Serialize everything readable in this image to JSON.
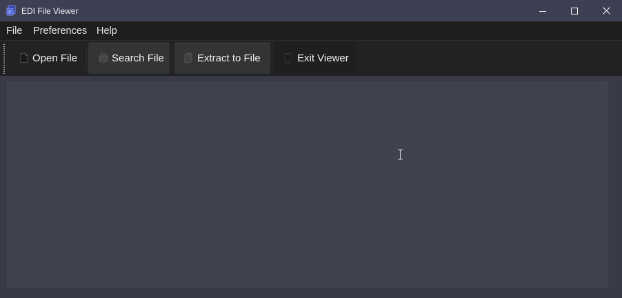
{
  "window": {
    "title": "EDI File Viewer",
    "controls": {
      "minimize_icon": "minimize-icon",
      "maximize_icon": "maximize-icon",
      "close_icon": "close-icon"
    }
  },
  "menu": {
    "items": [
      {
        "label": "File"
      },
      {
        "label": "Preferences"
      },
      {
        "label": "Help"
      }
    ]
  },
  "toolbar": {
    "buttons": [
      {
        "label": "Open File",
        "icon": "open-file-icon",
        "state": "normal"
      },
      {
        "label": "Search File",
        "icon": "search-file-icon",
        "state": "hover"
      },
      {
        "label": "Extract to File",
        "icon": "extract-file-icon",
        "state": "hover"
      },
      {
        "label": "Exit Viewer",
        "icon": "exit-icon",
        "state": "normal"
      }
    ]
  },
  "editor": {
    "content": ""
  },
  "colors": {
    "titlebar": "#3d3f52",
    "menubar": "#1e1e1e",
    "toolbar": "#222222",
    "button_hover": "#333436",
    "editor_bg": "#40414f",
    "text": "#f0f0f0"
  }
}
